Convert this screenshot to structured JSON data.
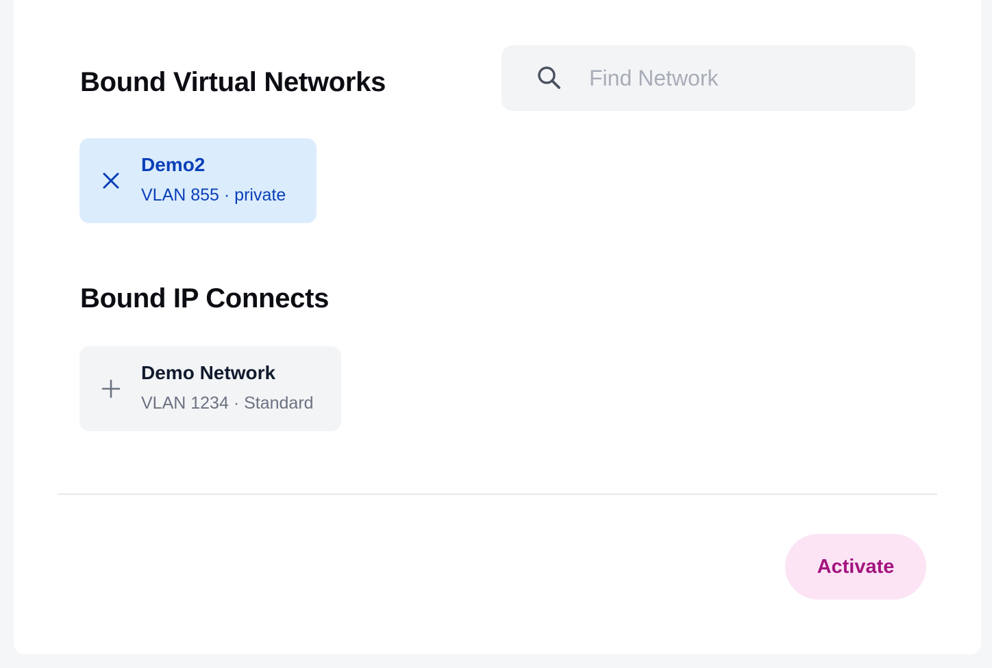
{
  "virtual_networks": {
    "title": "Bound Virtual Networks",
    "search": {
      "placeholder": "Find Network",
      "value": "",
      "icon": "search-icon"
    },
    "bound": [
      {
        "name": "Demo2",
        "vlan": "VLAN 855 · private",
        "action_icon": "close-icon",
        "selected": true
      }
    ]
  },
  "ip_connects": {
    "title": "Bound IP Connects",
    "items": [
      {
        "name": "Demo Network",
        "vlan": "VLAN 1234 · Standard",
        "action_icon": "plus-icon",
        "selected": false
      }
    ]
  },
  "footer": {
    "activate_label": "Activate"
  },
  "colors": {
    "selected_bg": "#dbecfd",
    "selected_text": "#0a3fb8",
    "available_bg": "#f3f4f6",
    "activate_bg": "#fce4f5",
    "activate_text": "#a3147e"
  }
}
